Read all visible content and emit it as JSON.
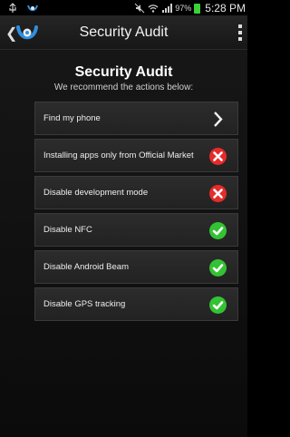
{
  "status_bar": {
    "battery_percent": "97%",
    "time": "5:28 PM"
  },
  "action_bar": {
    "title": "Security Audit"
  },
  "header": {
    "title": "Security Audit",
    "subtitle": "We recommend the actions below:"
  },
  "items": [
    {
      "label": "Find my phone",
      "status": "chevron",
      "icon": "chevron-right-icon"
    },
    {
      "label": "Installing apps only from Official Market",
      "status": "fail",
      "icon": "red-x-icon"
    },
    {
      "label": "Disable development mode",
      "status": "fail",
      "icon": "red-x-icon"
    },
    {
      "label": "Disable NFC",
      "status": "ok",
      "icon": "green-check-icon"
    },
    {
      "label": "Disable Android Beam",
      "status": "ok",
      "icon": "green-check-icon"
    },
    {
      "label": "Disable GPS tracking",
      "status": "ok",
      "icon": "green-check-icon"
    }
  ],
  "colors": {
    "fail": "#e52b2b",
    "ok": "#33c233",
    "logo_blue": "#2f8fe0"
  }
}
